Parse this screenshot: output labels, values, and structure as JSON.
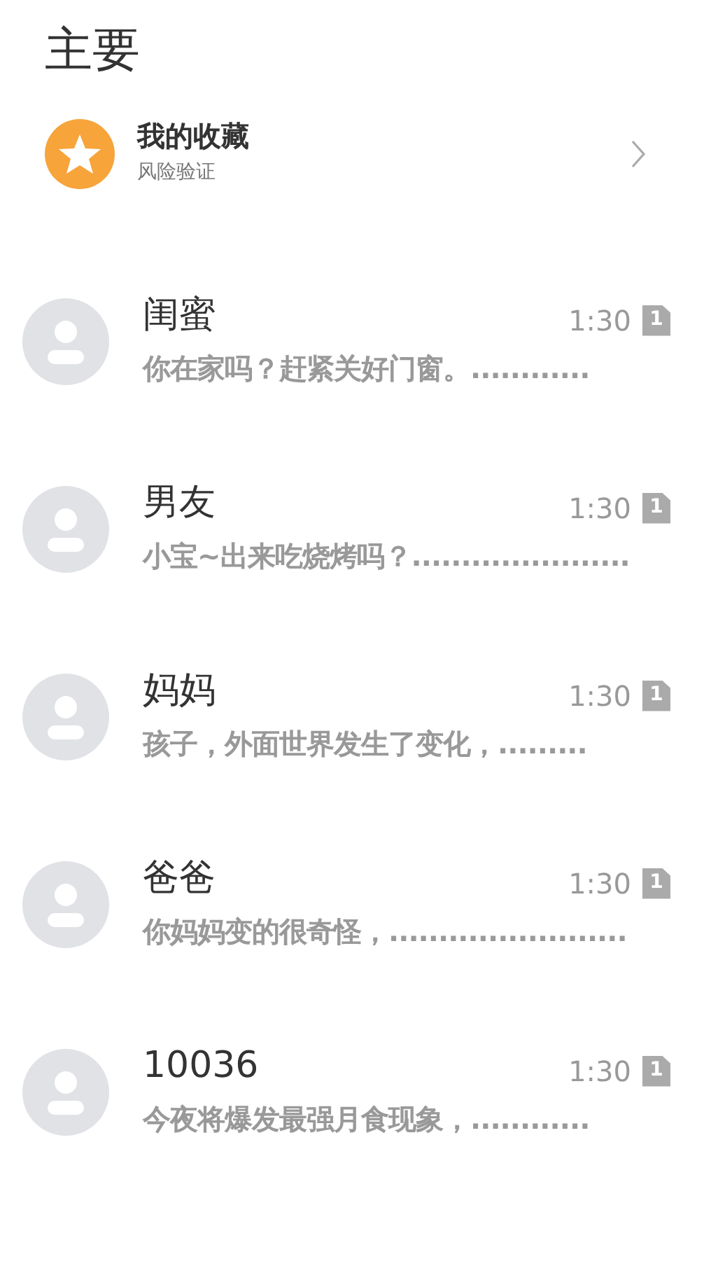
{
  "title": "主要",
  "favorites": {
    "title": "我的收藏",
    "subtitle": "风险验证"
  },
  "chats": [
    {
      "name": "闺蜜",
      "time": "1:30",
      "badge": "1",
      "message": "你在家吗？赶紧关好门窗。............"
    },
    {
      "name": "男友",
      "time": "1:30",
      "badge": "1",
      "message": "小宝~出来吃烧烤吗？......................"
    },
    {
      "name": "妈妈",
      "time": "1:30",
      "badge": "1",
      "message": "孩子，外面世界发生了变化，........."
    },
    {
      "name": "爸爸",
      "time": "1:30",
      "badge": "1",
      "message": "你妈妈变的很奇怪，........................"
    },
    {
      "name": "10036",
      "time": "1:30",
      "badge": "1",
      "message": "今夜将爆发最强月食现象，............"
    }
  ]
}
